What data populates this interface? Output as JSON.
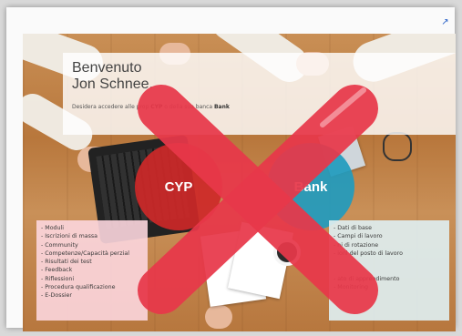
{
  "welcome": {
    "line1": "Benvenuto",
    "line2": "Jon Schnee.",
    "sub_prefix": "Desidera accedere alle prop",
    "sub_cyp": "CYP",
    "sub_middle": " o della sua banca ",
    "sub_bank": "Bank"
  },
  "circles": {
    "cyp": "CYP",
    "bank": "Bank"
  },
  "left_menu": [
    "- Moduli",
    "- Iscrizioni di massa",
    "- Community",
    "- Competenze/Capacità perzial",
    "- Risultati dei test",
    "- Feedback",
    "- Riflessioni",
    "- Procedura qualificazione",
    "- E-Dossier"
  ],
  "right_menu": [
    "- Dati di base",
    "- Campi di lavoro",
    "- ni di rotazione",
    "- ioni del posto di lavoro",
    "",
    "",
    "- ato di apprendimento",
    "- Monitoring"
  ],
  "icons": {
    "external_link": "external-link-icon",
    "overlay": "red-x-icon"
  },
  "colors": {
    "cyp": "#cd2828",
    "bank": "#219bbe",
    "x": "#e8384a"
  }
}
